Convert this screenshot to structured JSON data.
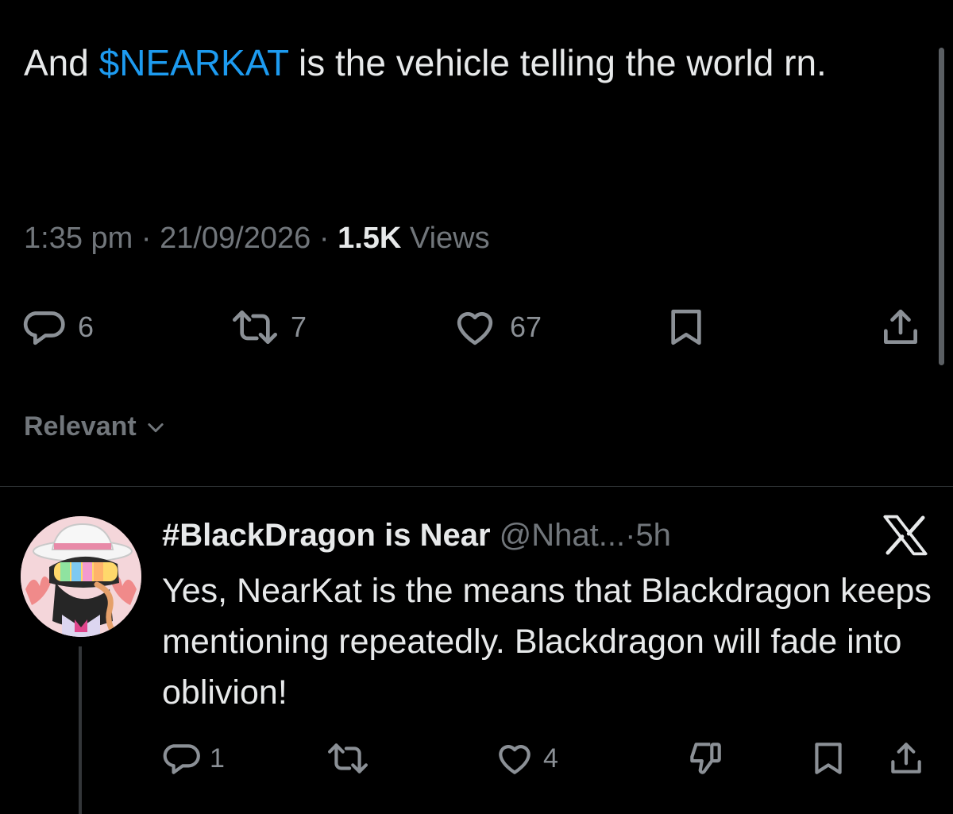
{
  "post": {
    "text_before": "And ",
    "cashtag": "$NEARKAT",
    "text_after": " is the vehicle telling the world rn.",
    "time": "1:35 pm",
    "separator": "·",
    "date": "21/09/2026",
    "views_count": "1.5K",
    "views_label": "Views",
    "actions": {
      "reply_count": "6",
      "repost_count": "7",
      "like_count": "67"
    }
  },
  "sort": {
    "label": "Relevant"
  },
  "reply": {
    "display_name": "#BlackDragon is Near",
    "handle": "@Nhat...",
    "separator": "·",
    "age": "5h",
    "text": "Yes, NearKat is the means that Blackdragon keeps mentioning repeatedly. Blackdragon will fade into oblivion!",
    "actions": {
      "reply_count": "1",
      "like_count": "4"
    }
  },
  "colors": {
    "background": "#000000",
    "text": "#e7e9ea",
    "muted": "#71767b",
    "accent": "#1d9bf0",
    "divider": "#2f3336"
  },
  "icons": {
    "reply": "speech-bubble-icon",
    "repost": "repost-arrows-icon",
    "like": "heart-icon",
    "bookmark": "bookmark-icon",
    "share": "share-upload-icon",
    "dislike": "thumbs-down-icon",
    "chevron": "chevron-down-icon",
    "logo": "x-logo-icon"
  }
}
